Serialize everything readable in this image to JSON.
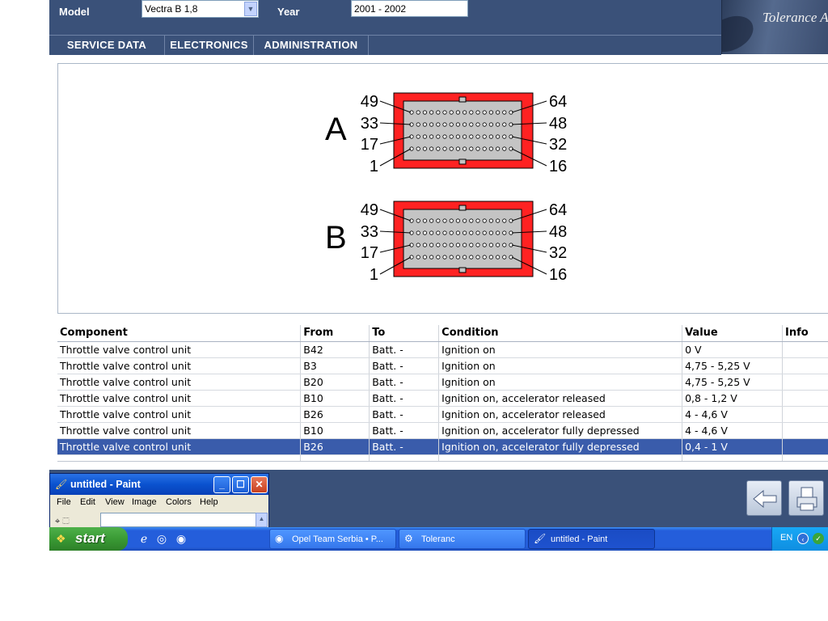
{
  "header": {
    "model_label": "Model",
    "model_value": "Vectra B 1,8",
    "year_label": "Year",
    "year_value": "2001 - 2002",
    "logo_text": "Tolerance A"
  },
  "nav": {
    "items": [
      {
        "label": "SERVICE DATA"
      },
      {
        "label": "ELECTRONICS"
      },
      {
        "label": "ADMINISTRATION"
      }
    ]
  },
  "diagram": {
    "connectors": [
      {
        "letter": "A",
        "pins_left": [
          "49",
          "33",
          "17",
          "1"
        ],
        "pins_right": [
          "64",
          "48",
          "32",
          "16"
        ]
      },
      {
        "letter": "B",
        "pins_left": [
          "49",
          "33",
          "17",
          "1"
        ],
        "pins_right": [
          "64",
          "48",
          "32",
          "16"
        ]
      }
    ],
    "colors": {
      "housing": "#ff2222",
      "insert": "#c4c4c4"
    }
  },
  "table": {
    "headers": {
      "component": "Component",
      "from": "From",
      "to": "To",
      "condition": "Condition",
      "value": "Value",
      "info": "Info"
    },
    "rows": [
      {
        "component": "Throttle valve control unit",
        "from": "B42",
        "to": "Batt. -",
        "condition": "Ignition on",
        "value": "0 V",
        "info": ""
      },
      {
        "component": "Throttle valve control unit",
        "from": "B3",
        "to": "Batt. -",
        "condition": "Ignition on",
        "value": "4,75 - 5,25 V",
        "info": ""
      },
      {
        "component": "Throttle valve control unit",
        "from": "B20",
        "to": "Batt. -",
        "condition": "Ignition on",
        "value": "4,75 - 5,25 V",
        "info": ""
      },
      {
        "component": "Throttle valve control unit",
        "from": "B10",
        "to": "Batt. -",
        "condition": "Ignition on, accelerator released",
        "value": "0,8 - 1,2 V",
        "info": ""
      },
      {
        "component": "Throttle valve control unit",
        "from": "B26",
        "to": "Batt. -",
        "condition": "Ignition on, accelerator released",
        "value": "4 - 4,6 V",
        "info": ""
      },
      {
        "component": "Throttle valve control unit",
        "from": "B10",
        "to": "Batt. -",
        "condition": "Ignition on, accelerator fully depressed",
        "value": "4 - 4,6 V",
        "info": ""
      },
      {
        "component": "Throttle valve control unit",
        "from": "B26",
        "to": "Batt. -",
        "condition": "Ignition on, accelerator fully depressed",
        "value": "0,4 - 1 V",
        "info": "",
        "selected": true
      }
    ]
  },
  "paint": {
    "title": "untitled - Paint",
    "menu": [
      "File",
      "Edit",
      "View",
      "Image",
      "Colors",
      "Help"
    ]
  },
  "taskbar": {
    "start_label": "start",
    "tasks": [
      {
        "label": "Opel Team Serbia • P...",
        "icon": "chrome-icon"
      },
      {
        "label": "Toleranc",
        "icon": "tolerance-app-icon"
      },
      {
        "label": "untitled - Paint",
        "icon": "paint-icon",
        "active": true
      }
    ],
    "lang": "EN"
  },
  "colors": {
    "header_bg": "#3a5179",
    "selected_row": "#3a5cab",
    "taskbar_blue": "#245edb",
    "start_green": "#3a9a35"
  }
}
